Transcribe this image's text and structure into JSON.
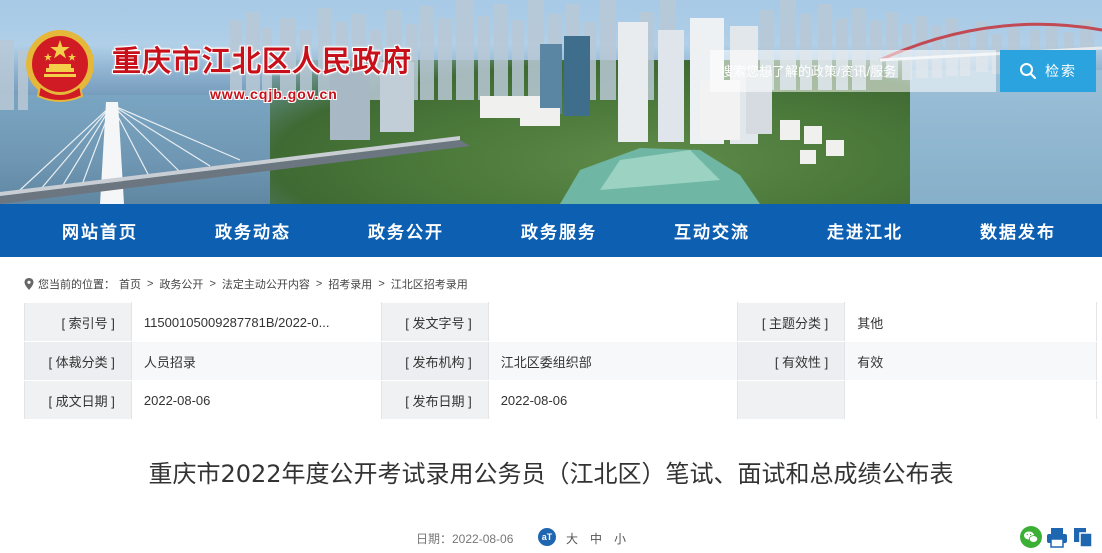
{
  "header": {
    "site_name": "重庆市江北区人民政府",
    "site_url": "www.cqjb.gov.cn",
    "emblem_icon": "national-emblem-icon",
    "search": {
      "placeholder": "搜索您想了解的政策/资讯/服务",
      "button_label": "检索",
      "button_icon": "search-icon"
    },
    "colors": {
      "brand_red": "#c8101a",
      "search_blue": "#2aa3df"
    }
  },
  "nav": {
    "color": "#0d5fb2",
    "items": [
      {
        "label": "网站首页"
      },
      {
        "label": "政务动态"
      },
      {
        "label": "政务公开"
      },
      {
        "label": "政务服务"
      },
      {
        "label": "互动交流"
      },
      {
        "label": "走进江北"
      },
      {
        "label": "数据发布"
      }
    ]
  },
  "breadcrumb": {
    "icon": "location-pin-icon",
    "prefix": "您当前的位置：",
    "items": [
      {
        "label": "首页"
      },
      {
        "label": "政务公开"
      },
      {
        "label": "法定主动公开内容"
      },
      {
        "label": "招考录用"
      },
      {
        "label": "江北区招考录用"
      }
    ],
    "separator": ">"
  },
  "info_table": {
    "rows": [
      [
        {
          "label": "[ 索引号 ]",
          "value": "11500105009287781B/2022-0..."
        },
        {
          "label": "[ 发文字号 ]",
          "value": ""
        },
        {
          "label": "[ 主题分类 ]",
          "value": "其他"
        }
      ],
      [
        {
          "label": "[ 体裁分类 ]",
          "value": "人员招录"
        },
        {
          "label": "[ 发布机构 ]",
          "value": "江北区委组织部"
        },
        {
          "label": "[ 有效性 ]",
          "value": "有效"
        }
      ],
      [
        {
          "label": "[ 成文日期 ]",
          "value": "2022-08-06"
        },
        {
          "label": "[ 发布日期 ]",
          "value": "2022-08-06"
        },
        {
          "label": "",
          "value": ""
        }
      ]
    ]
  },
  "article": {
    "title": "重庆市2022年度公开考试录用公务员（江北区）笔试、面试和总成绩公布表",
    "date": "日期：2022-08-06",
    "font_size_icon_label": "aT",
    "font_sizes": [
      "大",
      "中",
      "小"
    ],
    "share_icons": [
      "wechat-icon",
      "print-icon",
      "copy-icon"
    ]
  }
}
